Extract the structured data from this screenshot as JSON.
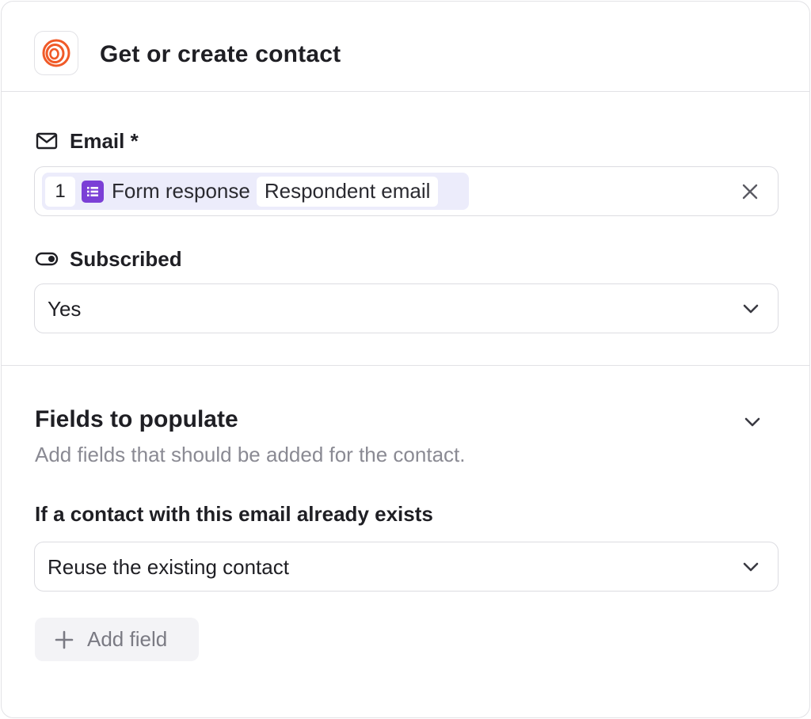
{
  "header": {
    "title": "Get or create contact",
    "app_icon": "loops-logo-icon",
    "accent": "#f05a28"
  },
  "email_field": {
    "label": "Email *",
    "icon": "mail-icon",
    "chip_step": "1",
    "chip_source_icon": "form-list-icon",
    "chip_source": "Form response",
    "chip_value": "Respondent email",
    "chip_color": "#7b3fd6",
    "chip_bg": "#ececfb"
  },
  "subscribed_field": {
    "label": "Subscribed",
    "icon": "toggle-icon",
    "value": "Yes"
  },
  "fields_section": {
    "title": "Fields to populate",
    "description": "Add fields that should be added for the contact."
  },
  "exists_field": {
    "label": "If a contact with this email already exists",
    "value": "Reuse the existing contact"
  },
  "add_field_button": {
    "label": "Add field"
  }
}
